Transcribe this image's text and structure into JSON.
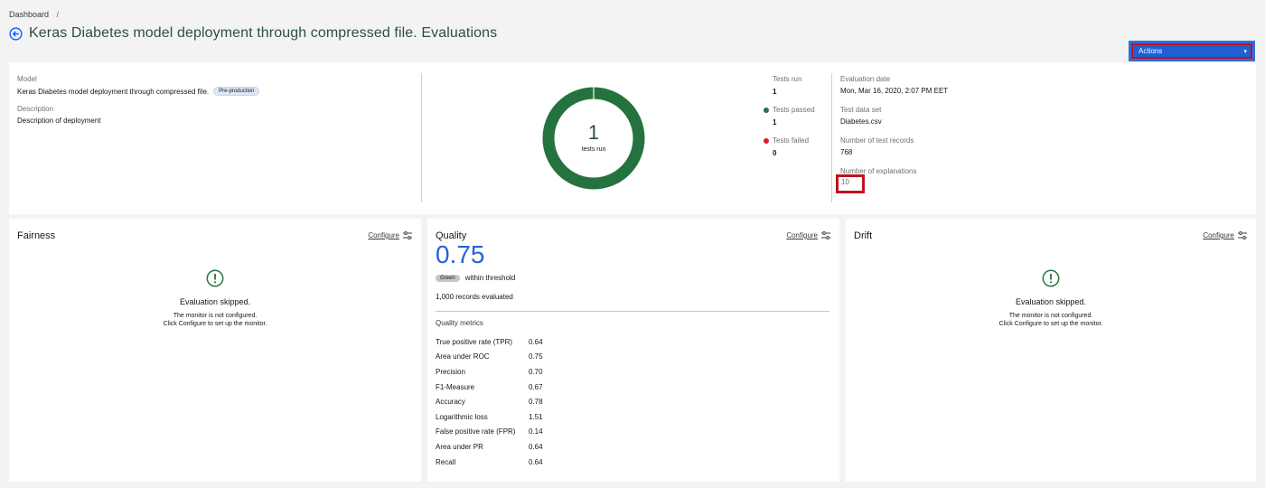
{
  "breadcrumb": {
    "root": "Dashboard",
    "separator": "/"
  },
  "header": {
    "title": "Keras Diabetes model deployment through compressed file. Evaluations"
  },
  "actions": {
    "label": "Actions"
  },
  "summary": {
    "model_label": "Model",
    "model_name": "Keras Diabetes model deployment through compressed file.",
    "model_tag": "Pre-production",
    "description_label": "Description",
    "description": "Description of deployment",
    "donut": {
      "number": "1",
      "label": "tests run",
      "passed_fraction": 1.0
    },
    "tests": [
      {
        "label": "Tests run",
        "value": "1",
        "color": ""
      },
      {
        "label": "Tests passed",
        "value": "1",
        "color": "#24733e"
      },
      {
        "label": "Tests failed",
        "value": "0",
        "color": "#da1e28"
      }
    ],
    "evaluation": [
      {
        "label": "Evaluation date",
        "value": "Mon, Mar 16, 2020, 2:07 PM EET"
      },
      {
        "label": "Test data set",
        "value": "Diabetes.csv"
      },
      {
        "label": "Number of test records",
        "value": "768"
      },
      {
        "label": "Number of explanations",
        "value": "10"
      }
    ]
  },
  "fairness": {
    "title": "Fairness",
    "configure": "Configure",
    "skipped_title": "Evaluation skipped.",
    "skipped_line1": "The monitor is not configured.",
    "skipped_line2": "Click Configure to set up the monitor."
  },
  "quality": {
    "title": "Quality",
    "configure": "Configure",
    "value": "0.75",
    "status_tag": "Green",
    "status_text": "within threshold",
    "records": "1,000 records evaluated",
    "metrics_title": "Quality metrics",
    "metrics": [
      {
        "name": "True positive rate (TPR)",
        "value": "0.64"
      },
      {
        "name": "Area under ROC",
        "value": "0.75"
      },
      {
        "name": "Precision",
        "value": "0.70"
      },
      {
        "name": "F1-Measure",
        "value": "0.67"
      },
      {
        "name": "Accuracy",
        "value": "0.78"
      },
      {
        "name": "Logarithmic loss",
        "value": "1.51"
      },
      {
        "name": "False positive rate (FPR)",
        "value": "0.14"
      },
      {
        "name": "Area under PR",
        "value": "0.64"
      },
      {
        "name": "Recall",
        "value": "0.64"
      }
    ]
  },
  "drift": {
    "title": "Drift",
    "configure": "Configure",
    "skipped_title": "Evaluation skipped.",
    "skipped_line1": "The monitor is not configured.",
    "skipped_line2": "Click Configure to set up the monitor."
  },
  "colors": {
    "accent": "#2563d6",
    "donut": "#24733e",
    "title": "#2d4f3c",
    "highlight": "#c1121f"
  }
}
